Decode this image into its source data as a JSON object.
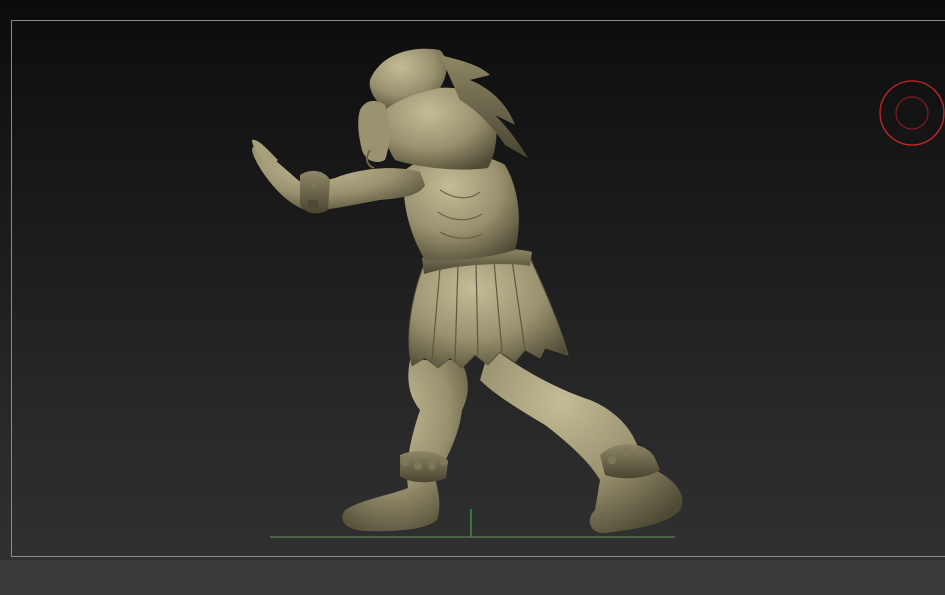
{
  "canvas": {
    "background_top": "#0c0c0c",
    "background_bottom": "#323232",
    "frame_border_color": "#8a8a8a"
  },
  "model": {
    "clay_color": "#a79f7a",
    "clay_shadow": "#5e583f",
    "clay_highlight": "#c9c19a"
  },
  "floor": {
    "line_color": "#5f7a5a",
    "axis_color": "#3f9a4a"
  },
  "gizmo": {
    "color": "#c8242a",
    "icon": "navigation-circle-icon"
  }
}
